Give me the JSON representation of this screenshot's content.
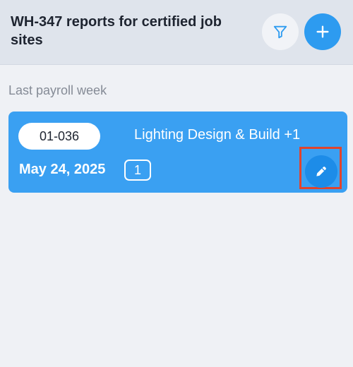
{
  "header": {
    "title": "WH-347 reports for certified job sites",
    "filter_icon": "filter-icon",
    "add_icon": "plus-icon"
  },
  "section": {
    "title": "Last payroll week"
  },
  "report_card": {
    "code": "01-036",
    "name": "Lighting Design & Build +1",
    "date": "May 24, 2025",
    "count": "1",
    "edit_icon": "pencil-icon"
  },
  "colors": {
    "header_bg": "#dfe4ec",
    "page_bg": "#eff1f5",
    "accent": "#2d9bf0",
    "card_bg": "#3aa0f2",
    "highlight": "#e0442d"
  }
}
